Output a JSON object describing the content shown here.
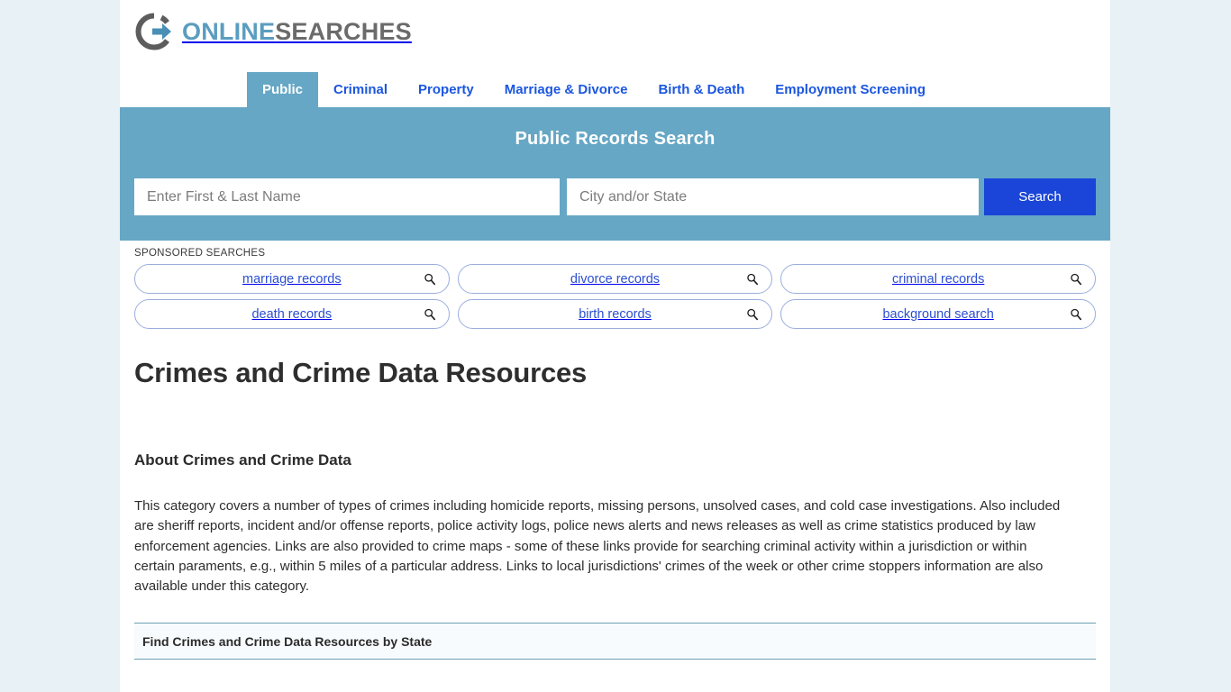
{
  "site": {
    "logo_primary": "ONLINE",
    "logo_secondary": "SEARCHES",
    "logo_icon": "circle-arrow-logo-icon",
    "brand_blue": "#5b9dc0",
    "brand_gray": "#6b6b6b",
    "banner_teal": "#66a7c5",
    "link_blue": "#1b56e0",
    "button_blue": "#1a45d8",
    "page_background": "#e8f1f5"
  },
  "nav": {
    "tabs": [
      {
        "label": "Public",
        "active": true
      },
      {
        "label": "Criminal",
        "active": false
      },
      {
        "label": "Property",
        "active": false
      },
      {
        "label": "Marriage & Divorce",
        "active": false
      },
      {
        "label": "Birth & Death",
        "active": false
      },
      {
        "label": "Employment Screening",
        "active": false
      }
    ]
  },
  "search": {
    "title": "Public Records Search",
    "name_placeholder": "Enter First & Last Name",
    "name_value": "",
    "location_placeholder": "City and/or State",
    "location_value": "",
    "button_label": "Search"
  },
  "sponsored": {
    "label": "SPONSORED SEARCHES",
    "icon": "magnifier-icon",
    "items": [
      {
        "label": "marriage records"
      },
      {
        "label": "divorce records"
      },
      {
        "label": "criminal records"
      },
      {
        "label": "death records"
      },
      {
        "label": "birth records"
      },
      {
        "label": "background search"
      }
    ]
  },
  "main": {
    "page_title": "Crimes and Crime Data Resources",
    "about_heading": "About Crimes and Crime Data",
    "about_text": "This category covers a number of types of crimes including homicide reports, missing persons, unsolved cases, and cold case investigations. Also included are sheriff reports, incident and/or offense reports, police activity logs, police news alerts and news releases as well as crime statistics produced by law enforcement agencies. Links are also provided to crime maps - some of these links provide for searching criminal activity within a jurisdiction or within certain paraments, e.g., within 5 miles of a particular address. Links to local jurisdictions' crimes of the week or other crime stoppers information are also available under this category.",
    "state_section_title": "Find Crimes and Crime Data Resources by State"
  }
}
